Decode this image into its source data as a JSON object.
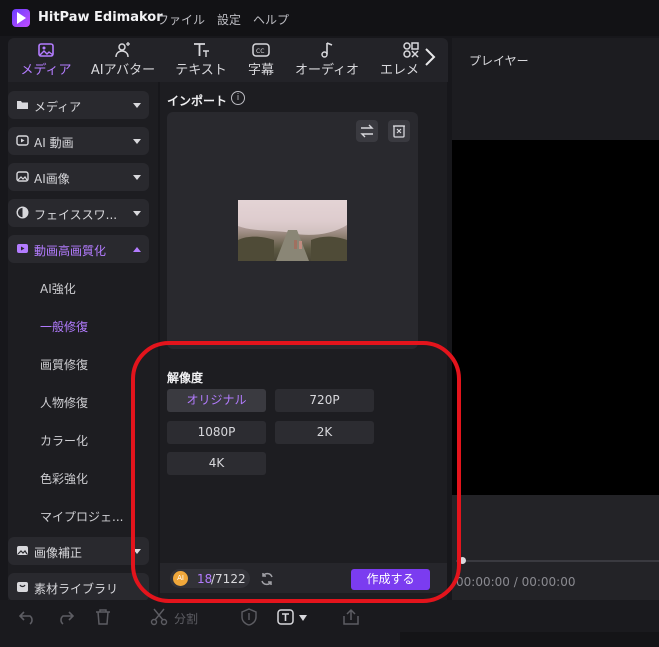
{
  "app": {
    "name": "HitPaw Edimakor",
    "menus": [
      "ファイル",
      "設定",
      "ヘルプ"
    ]
  },
  "toolbar": {
    "tabs": [
      {
        "label": "メディア",
        "icon": "media-icon",
        "active": true
      },
      {
        "label": "AIアバター",
        "icon": "ai-avatar-icon",
        "active": false
      },
      {
        "label": "テキスト",
        "icon": "text-icon",
        "active": false
      },
      {
        "label": "字幕",
        "icon": "subtitle-icon",
        "active": false
      },
      {
        "label": "オーディオ",
        "icon": "audio-icon",
        "active": false
      },
      {
        "label": "エレメ",
        "icon": "element-icon",
        "active": false
      }
    ],
    "next_icon": "chevron-right-icon"
  },
  "sidebar": {
    "categories": [
      {
        "label": "メディア",
        "icon": "folder-icon"
      },
      {
        "label": "AI 動画",
        "icon": "ai-video-icon"
      },
      {
        "label": "AI画像",
        "icon": "ai-image-icon"
      },
      {
        "label": "フェイススワ...",
        "icon": "face-swap-icon"
      },
      {
        "label": "動画高画質化",
        "icon": "video-enhance-icon",
        "active": true
      }
    ],
    "subitems": [
      {
        "label": "AI強化"
      },
      {
        "label": "一般修復",
        "active": true
      },
      {
        "label": "画質修復"
      },
      {
        "label": "人物修復"
      },
      {
        "label": "カラー化"
      },
      {
        "label": "色彩強化"
      },
      {
        "label": "マイプロジェ..."
      }
    ],
    "bottom_categories": [
      {
        "label": "画像補正",
        "icon": "image-correct-icon"
      },
      {
        "label": "素材ライブラリ",
        "icon": "library-icon"
      }
    ]
  },
  "import": {
    "title": "インポート",
    "info_icon": "info-icon",
    "replace_icon": "swap-icon",
    "delete_icon": "delete-icon"
  },
  "resolution": {
    "title": "解像度",
    "options": [
      {
        "label": "オリジナル",
        "selected": true
      },
      {
        "label": "720P"
      },
      {
        "label": "1080P"
      },
      {
        "label": "2K"
      },
      {
        "label": "4K"
      }
    ]
  },
  "footer": {
    "coin_label": "AI",
    "credits_used": "18",
    "credits_total": "/7122",
    "create_label": "作成する"
  },
  "player": {
    "title": "プレイヤー",
    "time": "00:00:00 / 00:00:00"
  },
  "bottom": {
    "split_label": "分割"
  },
  "colors": {
    "accent": "#b37cff",
    "create_button": "#7b3cf0",
    "annotation": "#e3141c"
  }
}
